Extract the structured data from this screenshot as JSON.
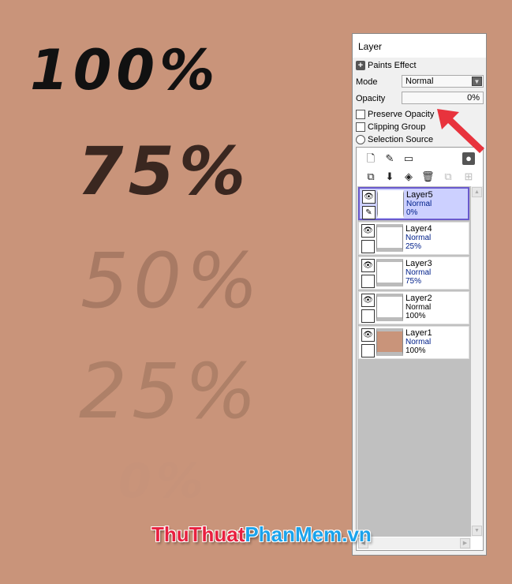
{
  "canvas": {
    "strokes": [
      "100%",
      "75%",
      "50%",
      "25%",
      "0%"
    ]
  },
  "panel": {
    "title": "Layer",
    "paints_effect": "Paints Effect",
    "mode_label": "Mode",
    "mode_value": "Normal",
    "opacity_label": "Opacity",
    "opacity_value": "0%",
    "preserve_opacity": "Preserve Opacity",
    "clipping_group": "Clipping Group",
    "selection_source": "Selection Source"
  },
  "layers": [
    {
      "name": "Layer5",
      "mode": "Normal",
      "opacity": "0%",
      "selected": true
    },
    {
      "name": "Layer4",
      "mode": "Normal",
      "opacity": "25%"
    },
    {
      "name": "Layer3",
      "mode": "Normal",
      "opacity": "75%"
    },
    {
      "name": "Layer2",
      "mode": "Normal",
      "opacity": "100%"
    },
    {
      "name": "Layer1",
      "mode": "Normal",
      "opacity": "100%"
    }
  ],
  "watermark": {
    "part1": "ThuThuat",
    "part2": "PhanMem",
    "part3": ".vn",
    "color1": "#e8203f",
    "color2": "#1aa3ec"
  },
  "colors": {
    "background": "#c9947a",
    "selected_layer": "#ccd0ff",
    "arrow": "#e8333d"
  }
}
